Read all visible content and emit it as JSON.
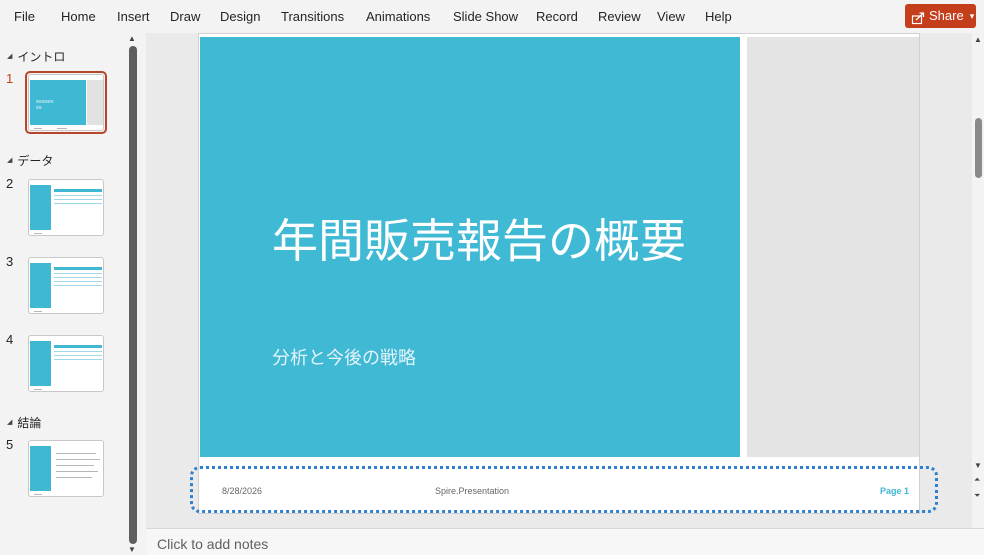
{
  "menu": {
    "items": [
      "File",
      "Home",
      "Insert",
      "Draw",
      "Design",
      "Transitions",
      "Animations",
      "Slide Show",
      "Record",
      "Review",
      "View",
      "Help"
    ],
    "share_label": "Share",
    "share_color": "#c43e1c"
  },
  "sections": [
    {
      "label": "イントロ"
    },
    {
      "label": "データ"
    },
    {
      "label": "結論"
    }
  ],
  "slides": [
    {
      "number": "1",
      "selected": true
    },
    {
      "number": "2",
      "selected": false
    },
    {
      "number": "3",
      "selected": false
    },
    {
      "number": "4",
      "selected": false
    },
    {
      "number": "5",
      "selected": false
    }
  ],
  "current_slide": {
    "title": "年間販売報告の概要",
    "subtitle": "分析と今後の戦略",
    "footer_date": "8/28/2026",
    "footer_center": "Spire.Presentation",
    "footer_page": "Page 1",
    "accent_color": "#40b9d5"
  },
  "notes": {
    "placeholder": "Click to add notes"
  }
}
